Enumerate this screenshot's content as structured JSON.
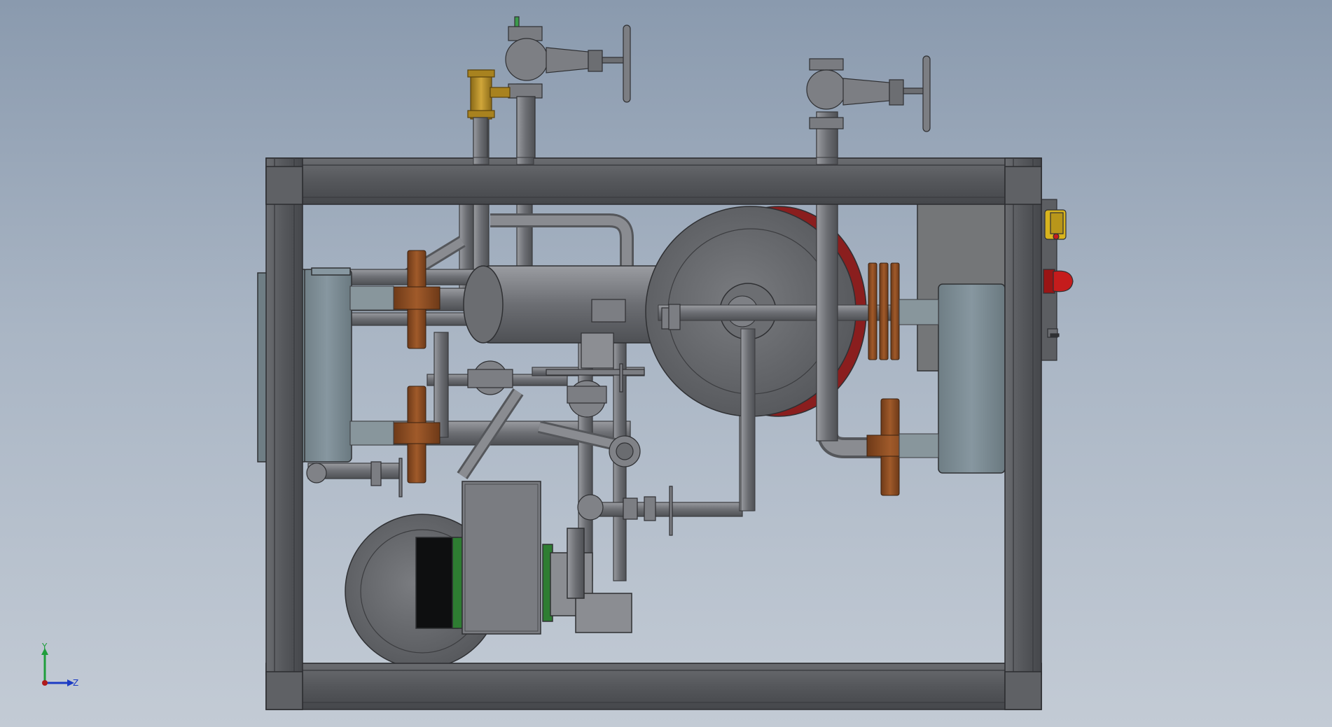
{
  "viewport": {
    "background_top": "#8a9aae",
    "background_bottom": "#c3cbd5"
  },
  "model": {
    "frame_color": "#5b5d61",
    "pipe_color": "#7b7d82",
    "flange_color": "#8a4a22",
    "heat_exchanger_color": "#7c8c92",
    "brass_color": "#b48a2a",
    "estop_color": "#c51c1c",
    "indicator_color": "#d8b41e",
    "motor_accent_color": "#2e7d32"
  },
  "triad": {
    "y_label": "Y",
    "z_label": "Z",
    "y_color": "#1f9e3c",
    "z_color": "#1c3cc4",
    "origin_color": "#b01a1a"
  }
}
